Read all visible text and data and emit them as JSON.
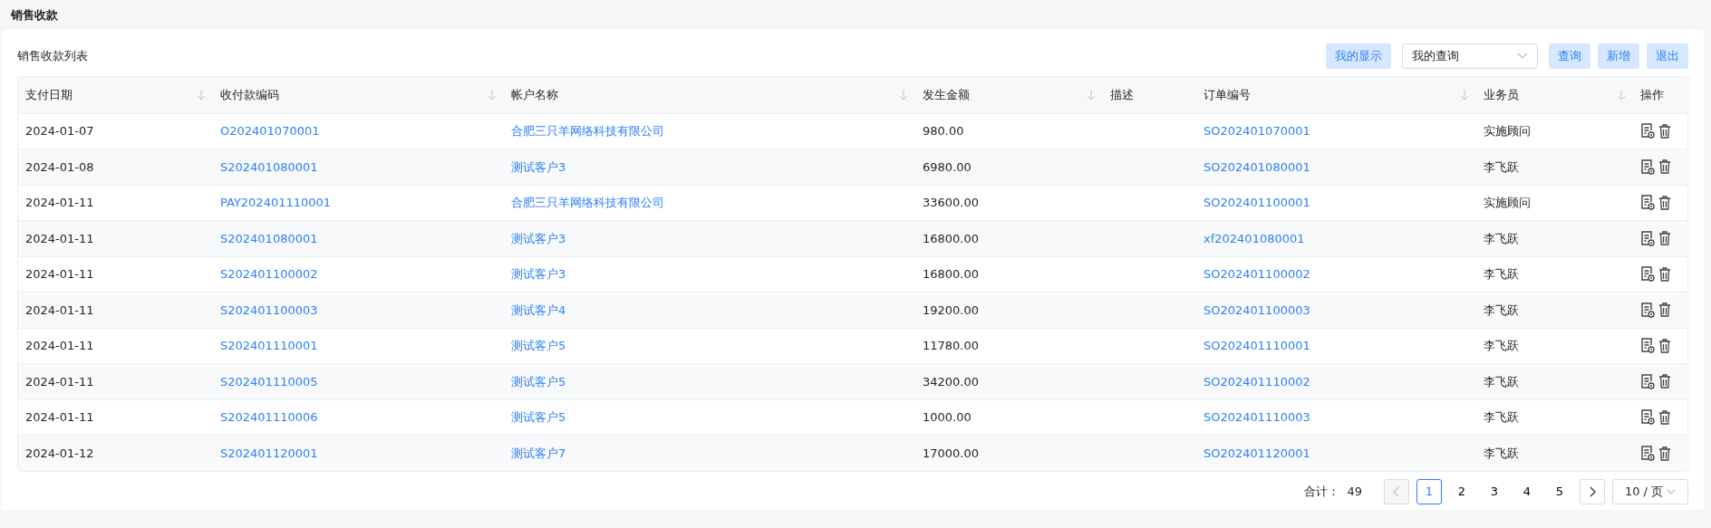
{
  "page_title": "销售收款",
  "list_title": "销售收款列表",
  "toolbar": {
    "display_button": "我的显示",
    "query_select": {
      "value": "我的查询"
    },
    "buttons": [
      "查询",
      "新增",
      "退出"
    ]
  },
  "table": {
    "columns": [
      {
        "label": "支付日期",
        "sortable": true,
        "kind": "text"
      },
      {
        "label": "收付款编码",
        "sortable": true,
        "kind": "link"
      },
      {
        "label": "帐户名称",
        "sortable": true,
        "kind": "link"
      },
      {
        "label": "发生金额",
        "sortable": true,
        "kind": "text"
      },
      {
        "label": "描述",
        "sortable": false,
        "kind": "text"
      },
      {
        "label": "订单编号",
        "sortable": true,
        "kind": "link"
      },
      {
        "label": "业务员",
        "sortable": true,
        "kind": "text"
      },
      {
        "label": "操作",
        "sortable": false,
        "kind": "actions"
      }
    ],
    "rows": [
      {
        "cells": [
          "2024-01-07",
          "O202401070001",
          "合肥三只羊网络科技有限公司",
          "980.00",
          "",
          "SO202401070001",
          "实施顾问"
        ]
      },
      {
        "cells": [
          "2024-01-08",
          "S202401080001",
          "测试客户3",
          "6980.00",
          "",
          "SO202401080001",
          "李飞跃"
        ]
      },
      {
        "cells": [
          "2024-01-11",
          "PAY202401110001",
          "合肥三只羊网络科技有限公司",
          "33600.00",
          "",
          "SO202401100001",
          "实施顾问"
        ]
      },
      {
        "cells": [
          "2024-01-11",
          "S202401080001",
          "测试客户3",
          "16800.00",
          "",
          "xf202401080001",
          "李飞跃"
        ]
      },
      {
        "cells": [
          "2024-01-11",
          "S202401100002",
          "测试客户3",
          "16800.00",
          "",
          "SO202401100002",
          "李飞跃"
        ]
      },
      {
        "cells": [
          "2024-01-11",
          "S202401100003",
          "测试客户4",
          "19200.00",
          "",
          "SO202401100003",
          "李飞跃"
        ]
      },
      {
        "cells": [
          "2024-01-11",
          "S202401110001",
          "测试客户5",
          "11780.00",
          "",
          "SO202401110001",
          "李飞跃"
        ]
      },
      {
        "cells": [
          "2024-01-11",
          "S202401110005",
          "测试客户5",
          "34200.00",
          "",
          "SO202401110002",
          "李飞跃"
        ]
      },
      {
        "cells": [
          "2024-01-11",
          "S202401110006",
          "测试客户5",
          "1000.00",
          "",
          "SO202401110003",
          "李飞跃"
        ]
      },
      {
        "cells": [
          "2024-01-12",
          "S202401120001",
          "测试客户7",
          "17000.00",
          "",
          "SO202401120001",
          "李飞跃"
        ]
      }
    ]
  },
  "pagination": {
    "total_label": "合计：",
    "total": "49",
    "prev_disabled": true,
    "next_disabled": false,
    "pages": [
      {
        "label": "1",
        "selected": true
      },
      {
        "label": "2",
        "selected": false
      },
      {
        "label": "3",
        "selected": false
      },
      {
        "label": "4",
        "selected": false
      },
      {
        "label": "5",
        "selected": false
      }
    ],
    "page_size": "10 / 页"
  }
}
